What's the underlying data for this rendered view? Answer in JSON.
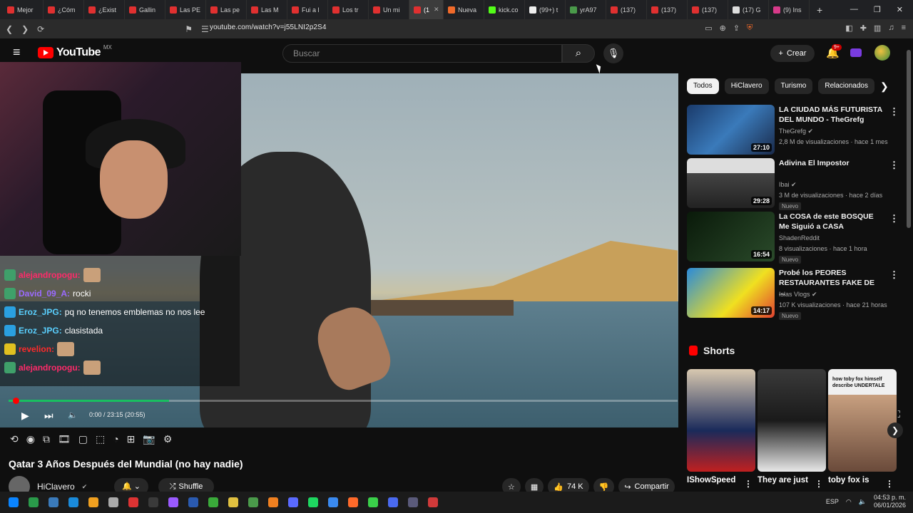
{
  "browser": {
    "tabs": [
      {
        "label": "Mejor",
        "color": "#e03030"
      },
      {
        "label": "¿Cóm",
        "color": "#e03030"
      },
      {
        "label": "¿Exist",
        "color": "#e03030"
      },
      {
        "label": "Gallin",
        "color": "#e03030"
      },
      {
        "label": "Las PE",
        "color": "#e03030"
      },
      {
        "label": "Las pe",
        "color": "#e03030"
      },
      {
        "label": "Las M",
        "color": "#e03030"
      },
      {
        "label": "Fui a l",
        "color": "#e03030"
      },
      {
        "label": "Los tr",
        "color": "#e03030"
      },
      {
        "label": "Un mi",
        "color": "#e03030"
      },
      {
        "label": "(1",
        "color": "#e03030",
        "active": true
      },
      {
        "label": "Nueva",
        "color": "#f06a2a"
      },
      {
        "label": "kick.co",
        "color": "#53fc18"
      },
      {
        "label": "(99+) t",
        "color": "#eeeeee"
      },
      {
        "label": "yrA97",
        "color": "#4a9a4a"
      },
      {
        "label": "(137)",
        "color": "#e03030"
      },
      {
        "label": "(137)",
        "color": "#e03030"
      },
      {
        "label": "(137)",
        "color": "#e03030"
      },
      {
        "label": "(17) G",
        "color": "#dddddd"
      },
      {
        "label": "(9) Ins",
        "color": "#d83a8a"
      }
    ],
    "url": "youtube.com/watch?v=j55LNI2p2S4"
  },
  "header": {
    "logo_text": "YouTube",
    "country": "MX",
    "search_placeholder": "Buscar",
    "create_label": "Crear",
    "notifications_badge": "9+"
  },
  "player": {
    "timecode": "0:00 / 23:15 (20:55)",
    "progress_loaded": 0.24,
    "title": "Qatar 3 Años Después del Mundial (no hay nadie)",
    "channel": "HiClavero",
    "shuffle_label": "Shuffle",
    "likes": "74 K",
    "share_label": "Compartir"
  },
  "chat": [
    {
      "user": "alejandropogu:",
      "msg": "",
      "user_color": "#ff2a6a",
      "emote": true
    },
    {
      "user": "David_09_A:",
      "msg": "rocki",
      "user_color": "#9a6aff",
      "emote": false
    },
    {
      "user": "Eroz_JPG:",
      "msg": "pq no tenemos emblemas no nos lee",
      "user_color": "#5ad0ff",
      "emote": false
    },
    {
      "user": "Eroz_JPG:",
      "msg": "clasistada",
      "user_color": "#5ad0ff",
      "emote": false
    },
    {
      "user": "revelion:",
      "msg": "",
      "user_color": "#ff2a2a",
      "emote": true
    },
    {
      "user": "alejandropogu:",
      "msg": "",
      "user_color": "#ff2a6a",
      "emote": true
    }
  ],
  "chips": [
    {
      "label": "Todos",
      "active": true
    },
    {
      "label": "HiClavero",
      "active": false
    },
    {
      "label": "Turismo",
      "active": false
    },
    {
      "label": "Relacionados",
      "active": false
    }
  ],
  "recommendations": [
    {
      "title": "LA CIUDAD MÁS FUTURISTA DEL MUNDO - TheGrefg",
      "channel": "TheGrefg ✔",
      "meta": "2,8 M de visualizaciones · hace 1 mes",
      "duration": "27:10",
      "new": "",
      "thumb": "linear-gradient(135deg,#1a3a6a,#3a7aba 50%,#1a2a4a)"
    },
    {
      "title": "Adivina El Impostor",
      "channel": "Ibai ✔",
      "meta": "3 M de visualizaciones · hace 2 días",
      "duration": "29:28",
      "new": "Nuevo",
      "thumb": "linear-gradient(180deg,#ddd 0 30%,#444 30%,#222)"
    },
    {
      "title": "La COSA de este BOSQUE Me Siguió a CASA",
      "channel": "ShadenReddit",
      "meta": "8 visualizaciones · hace 1 hora",
      "duration": "16:54",
      "new": "Nuevo",
      "thumb": "linear-gradient(135deg,#0a1a0a,#2a4a2a)"
    },
    {
      "title": "Probé los PEORES RESTAURANTES FAKE DE ...",
      "channel": "Islas Vlogs ✔",
      "meta": "107 K visualizaciones · hace 21 horas",
      "duration": "14:17",
      "new": "Nuevo",
      "thumb": "linear-gradient(135deg,#2a8ada,#f0e020 60%,#e04030)"
    }
  ],
  "shorts": {
    "heading": "Shorts",
    "items": [
      {
        "title": "IShowSpeed",
        "thumb": "linear-gradient(180deg,#d8c8b0,#1a2a5a 60%,#c02020)"
      },
      {
        "title": "They are just",
        "thumb": "linear-gradient(180deg,#3a3a3a,#1a1a1a 50%,#e8e8e8)"
      },
      {
        "title": "toby fox is",
        "thumb": "linear-gradient(180deg,#f0f0f0 0 25%,#c8a080 25%,#6a4a3a)"
      }
    ],
    "overlay_text": "how toby fox himself describe UNDERTALE"
  },
  "taskbar": {
    "lang": "ESP",
    "time": "04:53 p. m.",
    "date": "06/01/2026"
  }
}
